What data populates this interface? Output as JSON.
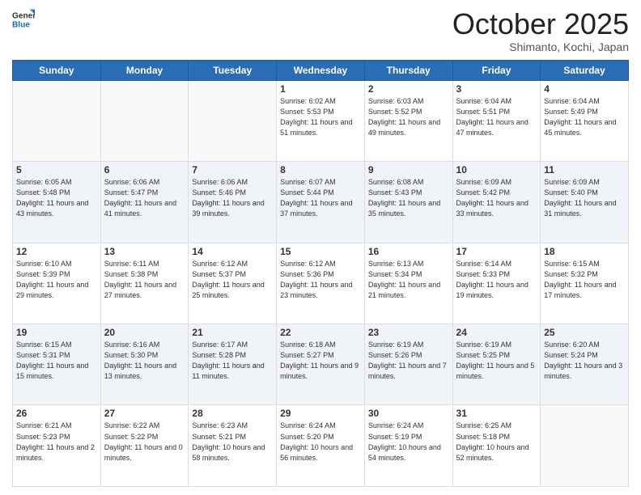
{
  "header": {
    "logo_general": "General",
    "logo_blue": "Blue",
    "month": "October 2025",
    "location": "Shimanto, Kochi, Japan"
  },
  "weekdays": [
    "Sunday",
    "Monday",
    "Tuesday",
    "Wednesday",
    "Thursday",
    "Friday",
    "Saturday"
  ],
  "weeks": [
    [
      {
        "day": "",
        "info": ""
      },
      {
        "day": "",
        "info": ""
      },
      {
        "day": "",
        "info": ""
      },
      {
        "day": "1",
        "info": "Sunrise: 6:02 AM\nSunset: 5:53 PM\nDaylight: 11 hours\nand 51 minutes."
      },
      {
        "day": "2",
        "info": "Sunrise: 6:03 AM\nSunset: 5:52 PM\nDaylight: 11 hours\nand 49 minutes."
      },
      {
        "day": "3",
        "info": "Sunrise: 6:04 AM\nSunset: 5:51 PM\nDaylight: 11 hours\nand 47 minutes."
      },
      {
        "day": "4",
        "info": "Sunrise: 6:04 AM\nSunset: 5:49 PM\nDaylight: 11 hours\nand 45 minutes."
      }
    ],
    [
      {
        "day": "5",
        "info": "Sunrise: 6:05 AM\nSunset: 5:48 PM\nDaylight: 11 hours\nand 43 minutes."
      },
      {
        "day": "6",
        "info": "Sunrise: 6:06 AM\nSunset: 5:47 PM\nDaylight: 11 hours\nand 41 minutes."
      },
      {
        "day": "7",
        "info": "Sunrise: 6:06 AM\nSunset: 5:46 PM\nDaylight: 11 hours\nand 39 minutes."
      },
      {
        "day": "8",
        "info": "Sunrise: 6:07 AM\nSunset: 5:44 PM\nDaylight: 11 hours\nand 37 minutes."
      },
      {
        "day": "9",
        "info": "Sunrise: 6:08 AM\nSunset: 5:43 PM\nDaylight: 11 hours\nand 35 minutes."
      },
      {
        "day": "10",
        "info": "Sunrise: 6:09 AM\nSunset: 5:42 PM\nDaylight: 11 hours\nand 33 minutes."
      },
      {
        "day": "11",
        "info": "Sunrise: 6:09 AM\nSunset: 5:40 PM\nDaylight: 11 hours\nand 31 minutes."
      }
    ],
    [
      {
        "day": "12",
        "info": "Sunrise: 6:10 AM\nSunset: 5:39 PM\nDaylight: 11 hours\nand 29 minutes."
      },
      {
        "day": "13",
        "info": "Sunrise: 6:11 AM\nSunset: 5:38 PM\nDaylight: 11 hours\nand 27 minutes."
      },
      {
        "day": "14",
        "info": "Sunrise: 6:12 AM\nSunset: 5:37 PM\nDaylight: 11 hours\nand 25 minutes."
      },
      {
        "day": "15",
        "info": "Sunrise: 6:12 AM\nSunset: 5:36 PM\nDaylight: 11 hours\nand 23 minutes."
      },
      {
        "day": "16",
        "info": "Sunrise: 6:13 AM\nSunset: 5:34 PM\nDaylight: 11 hours\nand 21 minutes."
      },
      {
        "day": "17",
        "info": "Sunrise: 6:14 AM\nSunset: 5:33 PM\nDaylight: 11 hours\nand 19 minutes."
      },
      {
        "day": "18",
        "info": "Sunrise: 6:15 AM\nSunset: 5:32 PM\nDaylight: 11 hours\nand 17 minutes."
      }
    ],
    [
      {
        "day": "19",
        "info": "Sunrise: 6:15 AM\nSunset: 5:31 PM\nDaylight: 11 hours\nand 15 minutes."
      },
      {
        "day": "20",
        "info": "Sunrise: 6:16 AM\nSunset: 5:30 PM\nDaylight: 11 hours\nand 13 minutes."
      },
      {
        "day": "21",
        "info": "Sunrise: 6:17 AM\nSunset: 5:28 PM\nDaylight: 11 hours\nand 11 minutes."
      },
      {
        "day": "22",
        "info": "Sunrise: 6:18 AM\nSunset: 5:27 PM\nDaylight: 11 hours\nand 9 minutes."
      },
      {
        "day": "23",
        "info": "Sunrise: 6:19 AM\nSunset: 5:26 PM\nDaylight: 11 hours\nand 7 minutes."
      },
      {
        "day": "24",
        "info": "Sunrise: 6:19 AM\nSunset: 5:25 PM\nDaylight: 11 hours\nand 5 minutes."
      },
      {
        "day": "25",
        "info": "Sunrise: 6:20 AM\nSunset: 5:24 PM\nDaylight: 11 hours\nand 3 minutes."
      }
    ],
    [
      {
        "day": "26",
        "info": "Sunrise: 6:21 AM\nSunset: 5:23 PM\nDaylight: 11 hours\nand 2 minutes."
      },
      {
        "day": "27",
        "info": "Sunrise: 6:22 AM\nSunset: 5:22 PM\nDaylight: 11 hours\nand 0 minutes."
      },
      {
        "day": "28",
        "info": "Sunrise: 6:23 AM\nSunset: 5:21 PM\nDaylight: 10 hours\nand 58 minutes."
      },
      {
        "day": "29",
        "info": "Sunrise: 6:24 AM\nSunset: 5:20 PM\nDaylight: 10 hours\nand 56 minutes."
      },
      {
        "day": "30",
        "info": "Sunrise: 6:24 AM\nSunset: 5:19 PM\nDaylight: 10 hours\nand 54 minutes."
      },
      {
        "day": "31",
        "info": "Sunrise: 6:25 AM\nSunset: 5:18 PM\nDaylight: 10 hours\nand 52 minutes."
      },
      {
        "day": "",
        "info": ""
      }
    ]
  ]
}
